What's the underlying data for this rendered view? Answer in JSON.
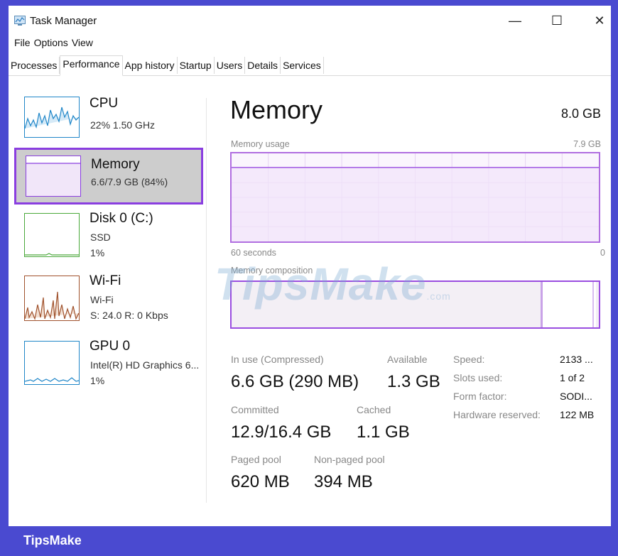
{
  "window": {
    "title": "Task Manager",
    "controls": {
      "minimize": "—",
      "maximize": "☐",
      "close": "✕"
    }
  },
  "menu": [
    "File",
    "Options",
    "View"
  ],
  "tabs": [
    "Processes",
    "Performance",
    "App history",
    "Startup",
    "Users",
    "Details",
    "Services"
  ],
  "active_tab": "Performance",
  "sidebar": {
    "items": [
      {
        "name": "CPU",
        "line1": "22%  1.50 GHz",
        "line2": "",
        "color": "#1f86c8"
      },
      {
        "name": "Memory",
        "line1": "6.6/7.9 GB (84%)",
        "line2": "",
        "color": "#8a3ee0"
      },
      {
        "name": "Disk 0 (C:)",
        "line1": "SSD",
        "line2": "1%",
        "color": "#4aa83a"
      },
      {
        "name": "Wi-Fi",
        "line1": "Wi-Fi",
        "line2": "S: 24.0  R: 0 Kbps",
        "color": "#a0522d"
      },
      {
        "name": "GPU 0",
        "line1": "Intel(R) HD Graphics 6...",
        "line2": "1%",
        "color": "#1f86c8"
      }
    ]
  },
  "main": {
    "title": "Memory",
    "total": "8.0 GB",
    "usage_label": "Memory usage",
    "usage_max": "7.9 GB",
    "time_left": "60 seconds",
    "time_right": "0",
    "composition_label": "Memory composition",
    "usage_level": 0.84,
    "stats": {
      "in_use_label": "In use (Compressed)",
      "in_use_value": "6.6 GB (290 MB)",
      "available_label": "Available",
      "available_value": "1.3 GB",
      "committed_label": "Committed",
      "committed_value": "12.9/16.4 GB",
      "cached_label": "Cached",
      "cached_value": "1.1 GB",
      "paged_label": "Paged pool",
      "paged_value": "620 MB",
      "nonpaged_label": "Non-paged pool",
      "nonpaged_value": "394 MB"
    },
    "specs": [
      {
        "label": "Speed:",
        "value": "2133 ..."
      },
      {
        "label": "Slots used:",
        "value": "1 of 2"
      },
      {
        "label": "Form factor:",
        "value": "SODI..."
      },
      {
        "label": "Hardware reserved:",
        "value": "122 MB"
      }
    ]
  },
  "watermark": {
    "text": "TipsMake",
    "suffix": ".com"
  },
  "brand": "TipsMake",
  "colors": {
    "accent": "#8a3ee0",
    "brand_bar": "#4a4ad0"
  }
}
